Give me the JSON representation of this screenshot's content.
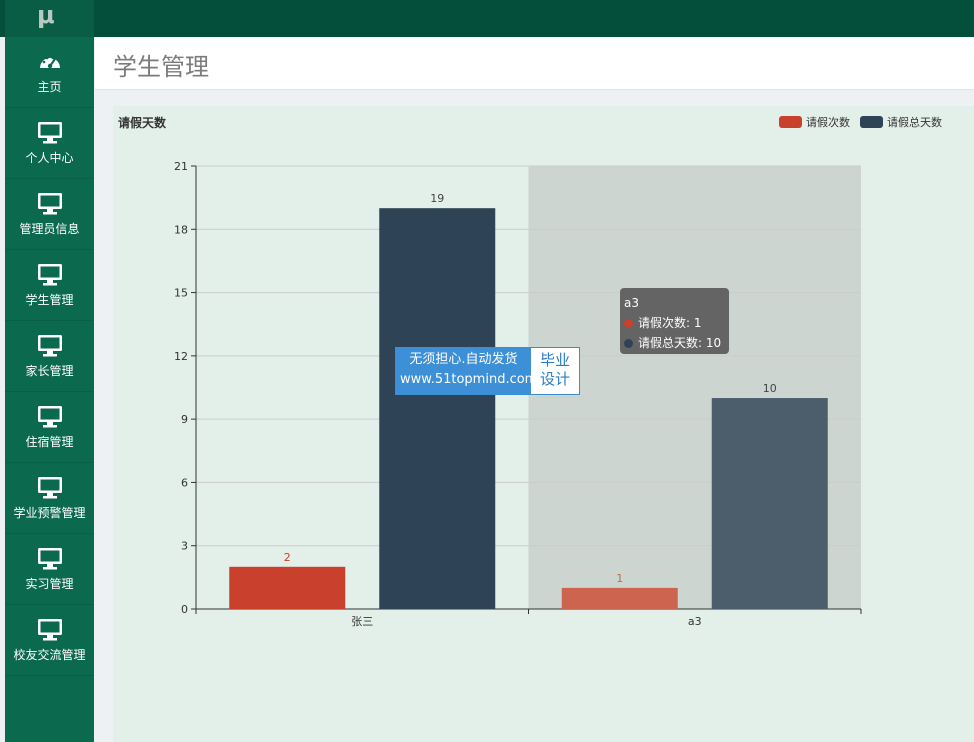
{
  "app": {
    "logo": "μ"
  },
  "sidebar": {
    "items": [
      {
        "label": "主页",
        "icon": "dashboard-icon"
      },
      {
        "label": "个人中心",
        "icon": "monitor-icon"
      },
      {
        "label": "管理员信息",
        "icon": "monitor-icon"
      },
      {
        "label": "学生管理",
        "icon": "monitor-icon"
      },
      {
        "label": "家长管理",
        "icon": "monitor-icon"
      },
      {
        "label": "住宿管理",
        "icon": "monitor-icon"
      },
      {
        "label": "学业预警管理",
        "icon": "monitor-icon"
      },
      {
        "label": "实习管理",
        "icon": "monitor-icon"
      },
      {
        "label": "校友交流管理",
        "icon": "monitor-icon"
      }
    ]
  },
  "header": {
    "title": "学生管理"
  },
  "panel": {
    "title": "请假天数"
  },
  "colors": {
    "series1": "#c9402c",
    "series2": "#2e4355",
    "topbar": "#034f3c",
    "sidebar": "#0b6a4d"
  },
  "chart_data": {
    "type": "bar",
    "title": "请假天数",
    "categories": [
      "张三",
      "a3"
    ],
    "series": [
      {
        "name": "请假次数",
        "values": [
          2,
          1
        ]
      },
      {
        "name": "请假总天数",
        "values": [
          19,
          10
        ]
      }
    ],
    "ylim": [
      0,
      21
    ],
    "yticks": [
      0,
      3,
      6,
      9,
      12,
      15,
      18,
      21
    ],
    "legend": "top-right",
    "grid": true,
    "highlighted_category": "a3"
  },
  "tooltip": {
    "title": "a3",
    "rows": [
      {
        "text": "请假次数: 1"
      },
      {
        "text": "请假总天数: 10"
      }
    ]
  },
  "watermark": {
    "line1": "无须担心.自动发货",
    "line2": "www.51topmind.com",
    "right1": "毕业",
    "right2": "设计"
  }
}
